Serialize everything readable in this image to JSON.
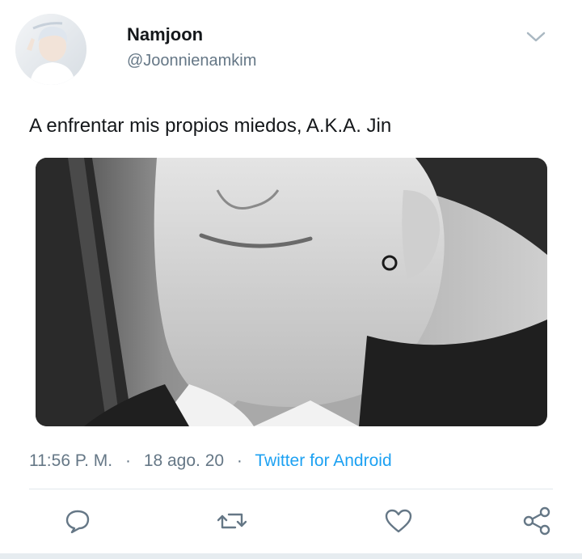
{
  "author": {
    "name": "Namjoon",
    "handle": "@Joonnienamkim"
  },
  "tweet": {
    "text": "A enfrentar mis propios miedos, A.K.A. Jin",
    "time": "11:56 P. M.",
    "separator": "·",
    "date": "18 ago. 20",
    "source": "Twitter for Android"
  },
  "icons": {
    "menu": "chevron-down-icon",
    "reply": "comment-icon",
    "retweet": "retweet-icon",
    "like": "heart-icon",
    "share": "share-icon"
  },
  "colors": {
    "accent": "#1da1f2",
    "text": "#14171a",
    "secondary": "#657786",
    "divider": "#e1e8ed"
  }
}
